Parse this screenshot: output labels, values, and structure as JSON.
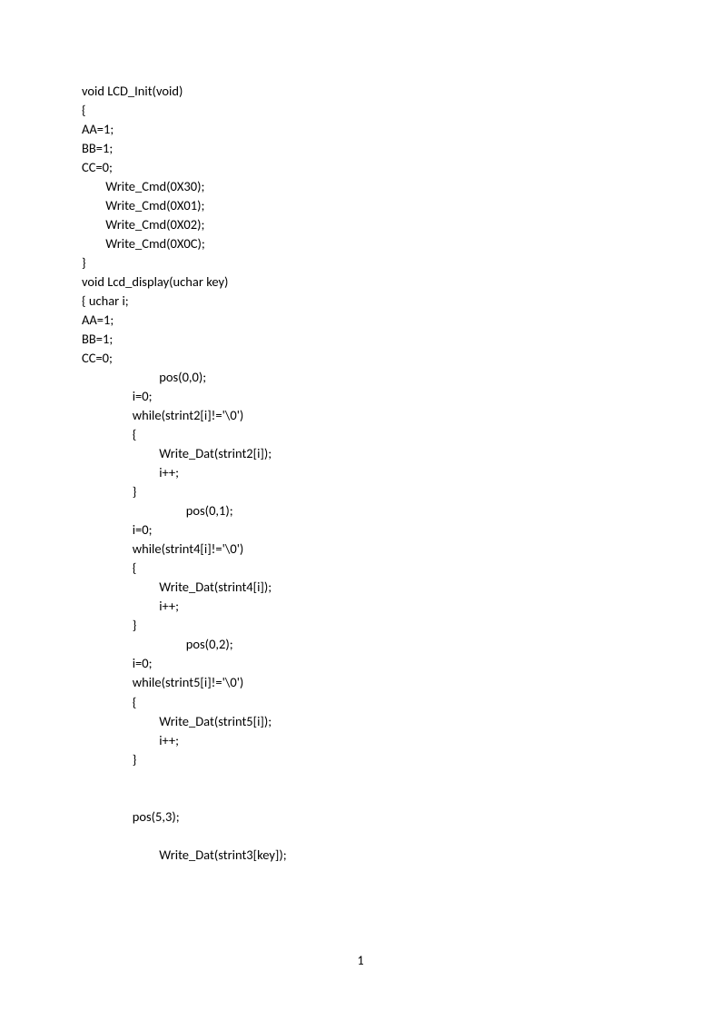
{
  "page_number": "1",
  "lines": [
    "void LCD_Init(void)",
    "{",
    "AA=1;",
    "BB=1;",
    "CC=0;",
    "        Write_Cmd(0X30);",
    "        Write_Cmd(0X01);",
    "        Write_Cmd(0X02);",
    "        Write_Cmd(0X0C);",
    "}",
    "void Lcd_display(uchar key)",
    "{ uchar i;",
    "AA=1;",
    "BB=1;",
    "CC=0;",
    "                          pos(0,0);",
    "                 i=0;",
    "                 while(strint2[i]!='\\0')",
    "                 {",
    "                          Write_Dat(strint2[i]);",
    "                          i++;",
    "                 }",
    "                                   pos(0,1);",
    "                 i=0;",
    "                 while(strint4[i]!='\\0')",
    "                 {",
    "                          Write_Dat(strint4[i]);",
    "                          i++;",
    "                 }",
    "                                   pos(0,2);",
    "                 i=0;",
    "                 while(strint5[i]!='\\0')",
    "                 {",
    "                          Write_Dat(strint5[i]);",
    "                          i++;",
    "                 }",
    "",
    "",
    "                 pos(5,3);",
    "",
    "                          Write_Dat(strint3[key]);"
  ]
}
